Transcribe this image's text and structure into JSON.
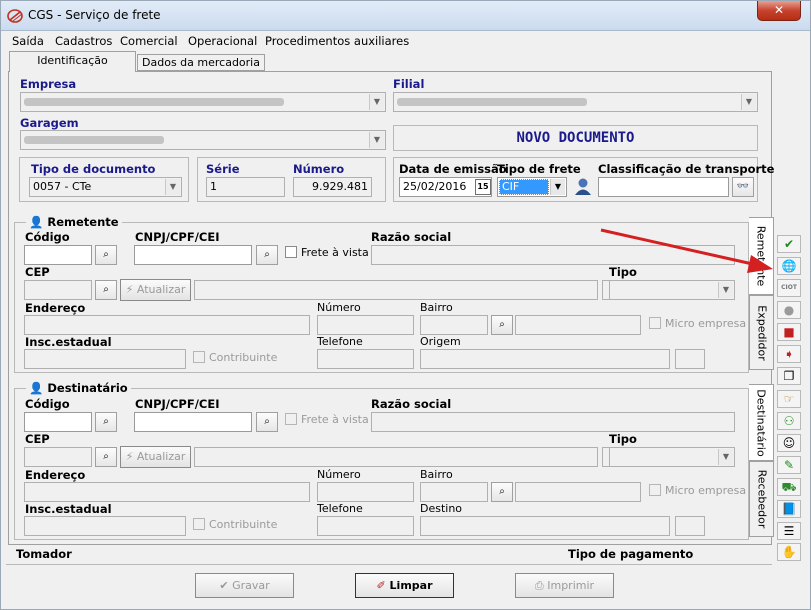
{
  "window": {
    "title": "CGS - Serviço de frete",
    "close_glyph": "✕"
  },
  "menu": [
    "Saída",
    "Cadastros",
    "Comercial",
    "Operacional",
    "Procedimentos auxiliares"
  ],
  "tabs": [
    "Identificação",
    "Dados da mercadoria"
  ],
  "labels": {
    "empresa": "Empresa",
    "filial": "Filial",
    "garagem": "Garagem",
    "tipo_documento": "Tipo de documento",
    "serie": "Série",
    "numero": "Número",
    "data_emissao": "Data de emissão",
    "tipo_frete": "Tipo de frete",
    "classificacao": "Classificação de transporte",
    "codigo": "Código",
    "cnpj": "CNPJ/CPF/CEI",
    "frete_vista": "Frete à vista",
    "razao": "Razão social",
    "cep": "CEP",
    "atualizar": "Atualizar",
    "tipo": "Tipo",
    "endereco": "Endereço",
    "numero2": "Número",
    "bairro": "Bairro",
    "micro": "Micro empresa",
    "insc": "Insc.estadual",
    "contribuinte": "Contribuinte",
    "telefone": "Telefone",
    "origem": "Origem",
    "destino": "Destino",
    "tomador": "Tomador",
    "tipo_pagamento": "Tipo de pagamento"
  },
  "banner": "NOVO DOCUMENTO",
  "values": {
    "tipo_documento": "0057 - CTe",
    "serie": "1",
    "numero": "9.929.481",
    "data_emissao": "25/02/2016",
    "tipo_frete": "CIF",
    "calendar": "15"
  },
  "groups": {
    "remetente": "Remetente",
    "destinatario": "Destinatário"
  },
  "side_tabs": [
    "Remetente",
    "Expedidor",
    "Destinatário",
    "Recebedor"
  ],
  "buttons": {
    "gravar": "Gravar",
    "limpar": "Limpar",
    "imprimir": "Imprimir"
  },
  "toolbar_icons": [
    "check-icon",
    "globe-icon",
    "ciot-icon",
    "circle-icon",
    "cube-icon",
    "export-icon",
    "documents-icon",
    "hand-icon",
    "people-icon",
    "user-icon",
    "notepad-icon",
    "truck-icon",
    "book-icon",
    "list-icon",
    "handshake-icon"
  ],
  "toolbar_ciot_label": "CIOT",
  "colors": {
    "banner": "#1a1a8c",
    "accent_arrow": "#d42020",
    "title_bar": "#cbdbee",
    "close": "#c7432e"
  }
}
